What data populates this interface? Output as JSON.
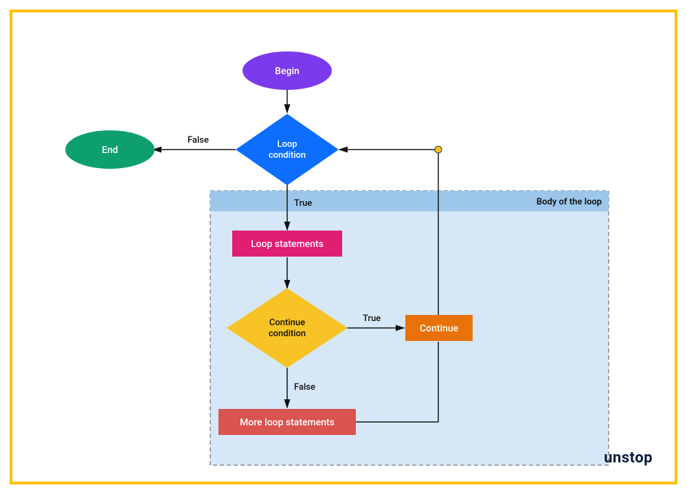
{
  "nodes": {
    "begin": "Begin",
    "end": "End",
    "loop_condition_l1": "Loop",
    "loop_condition_l2": "condition",
    "loop_statements": "Loop statements",
    "continue_cond_l1": "Continue",
    "continue_cond_l2": "condition",
    "continue": "Continue",
    "more_loop": "More loop statements"
  },
  "edges": {
    "false": "False",
    "true": "True",
    "true2": "True",
    "false2": "False"
  },
  "labels": {
    "body": "Body of the loop"
  },
  "logo": {
    "brand": "unstop"
  },
  "chart_data": {
    "type": "flowchart",
    "title": "Body of the loop",
    "nodes": [
      {
        "id": "begin",
        "shape": "ellipse",
        "label": "Begin",
        "fill": "#7C3AED"
      },
      {
        "id": "loop_condition",
        "shape": "diamond",
        "label": "Loop condition",
        "fill": "#0D6EFD"
      },
      {
        "id": "end",
        "shape": "ellipse",
        "label": "End",
        "fill": "#0E9F6E"
      },
      {
        "id": "loop_statements",
        "shape": "rect",
        "label": "Loop statements",
        "fill": "#E01E72"
      },
      {
        "id": "continue_condition",
        "shape": "diamond",
        "label": "Continue condition",
        "fill": "#F7C325"
      },
      {
        "id": "continue",
        "shape": "rect",
        "label": "Continue",
        "fill": "#E8710A"
      },
      {
        "id": "more_loop_statements",
        "shape": "rect",
        "label": "More loop statements",
        "fill": "#D9534F"
      }
    ],
    "edges": [
      {
        "from": "begin",
        "to": "loop_condition"
      },
      {
        "from": "loop_condition",
        "to": "end",
        "label": "False"
      },
      {
        "from": "loop_condition",
        "to": "loop_statements",
        "label": "True"
      },
      {
        "from": "loop_statements",
        "to": "continue_condition"
      },
      {
        "from": "continue_condition",
        "to": "continue",
        "label": "True"
      },
      {
        "from": "continue_condition",
        "to": "more_loop_statements",
        "label": "False"
      },
      {
        "from": "continue",
        "to": "loop_condition"
      },
      {
        "from": "more_loop_statements",
        "to": "loop_condition"
      }
    ],
    "groups": [
      {
        "label": "Body of the loop",
        "contains": [
          "loop_statements",
          "continue_condition",
          "continue",
          "more_loop_statements"
        ]
      }
    ]
  }
}
